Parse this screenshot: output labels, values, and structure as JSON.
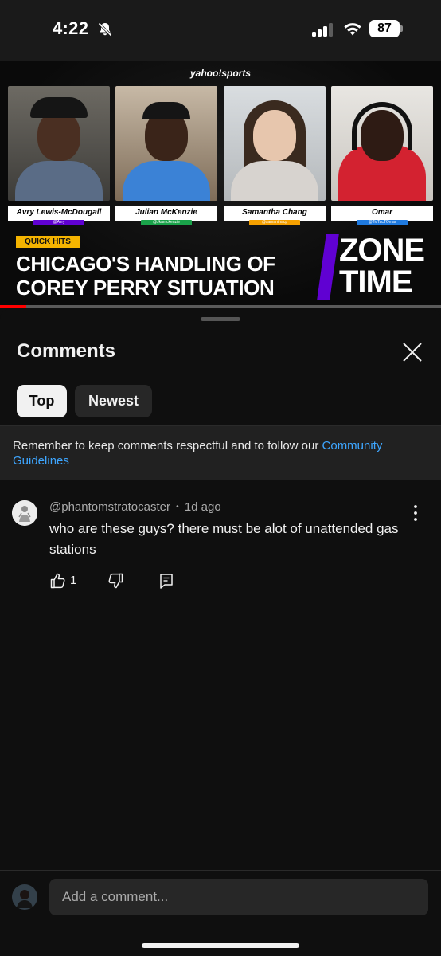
{
  "status_bar": {
    "time": "4:22",
    "battery": "87",
    "icons": [
      "bell-slash-icon",
      "cellular-signal-icon",
      "wifi-icon",
      "battery-icon"
    ]
  },
  "video": {
    "brand": "yahoo!sports",
    "panelists": [
      {
        "name": "Avry Lewis-McDougall",
        "handle": "@Avry",
        "handle_color": "#6001d2"
      },
      {
        "name": "Julian McKenzie",
        "handle": "@Jkamckenzie",
        "handle_color": "#1aa34a"
      },
      {
        "name": "Samantha Chang",
        "handle": "@samanthacp",
        "handle_color": "#f5a000"
      },
      {
        "name": "Omar",
        "handle": "@TicTacTOmar",
        "handle_color": "#1f7ae0"
      }
    ],
    "tag": "QUICK HITS",
    "headline_line1": "CHICAGO'S HANDLING OF",
    "headline_line2": "COREY PERRY SITUATION",
    "show_line1": "ZONE",
    "show_line2": "TIME",
    "progress_fraction": 0.06
  },
  "comments_panel": {
    "title": "Comments",
    "filters": [
      {
        "label": "Top",
        "selected": true
      },
      {
        "label": "Newest",
        "selected": false
      }
    ],
    "notice_text": "Remember to keep comments respectful and to follow our ",
    "notice_link": "Community Guidelines",
    "comments": [
      {
        "author": "@phantomstratocaster",
        "separator": "•",
        "age": "1d ago",
        "text": "who are these guys? there must be alot of unattended gas stations",
        "likes": "1"
      }
    ],
    "input_placeholder": "Add a comment..."
  },
  "colors": {
    "background": "#0f0f0f",
    "link": "#3ea6ff",
    "chip_selected": "#f1f1f1",
    "chip_unselected": "#272727",
    "accent_purple": "#6001d2",
    "quick_hits_yellow": "#f5b400"
  }
}
